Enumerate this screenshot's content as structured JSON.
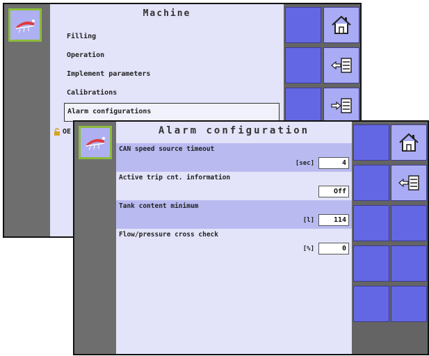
{
  "back_screen": {
    "title": "Machine",
    "menu_items": [
      {
        "label": "Filling"
      },
      {
        "label": "Operation"
      },
      {
        "label": "Implement parameters"
      },
      {
        "label": "Calibrations"
      },
      {
        "label": "Alarm configurations",
        "selected": true
      }
    ],
    "partial_item": "OE",
    "right_buttons": [
      "home-icon",
      "back-list-icon",
      "forward-list-icon"
    ]
  },
  "front_screen": {
    "title": "Alarm configuration",
    "params": [
      {
        "label": "CAN speed source timeout",
        "unit": "[sec]",
        "value": "4"
      },
      {
        "label": "Active trip cnt. information",
        "unit": "",
        "value": "Off"
      },
      {
        "label": "Tank content minimum",
        "unit": "[l]",
        "value": "114"
      },
      {
        "label": "Flow/pressure cross check",
        "unit": "[%]",
        "value": "0"
      }
    ],
    "right_buttons": [
      "home-icon",
      "back-list-icon"
    ]
  },
  "colors": {
    "panel": "#e3e3f9",
    "highlight_row": "#b8baf0",
    "button": "#6467e3",
    "icon_button": "#a9abf4",
    "logo_border": "#8dbb3c"
  }
}
